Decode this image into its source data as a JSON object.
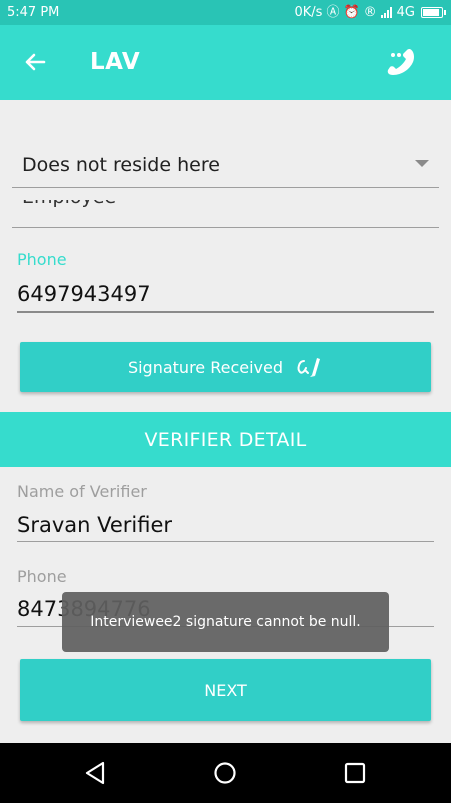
{
  "status_bar": {
    "time": "5:47 PM",
    "net_speed": "0K/s",
    "network": "4G",
    "icons": [
      "data-saver-icon",
      "alarm-icon",
      "registered-icon",
      "signal-icon",
      "battery-icon"
    ]
  },
  "toolbar": {
    "title": "LAV",
    "back_icon": "arrow-left-icon",
    "call_icon": "phone-dots-icon"
  },
  "form": {
    "residence_status": "Does not reside here",
    "clipped_field_value": "Employee",
    "phone_label": "Phone",
    "phone_value": "6497943497",
    "signature_button": "Signature Received",
    "signature_icon": "signature-pen-icon"
  },
  "verifier": {
    "section_title": "VERIFIER DETAIL",
    "name_label": "Name of Verifier",
    "name_value": "Sravan Verifier",
    "phone_label": "Phone",
    "phone_value": "8473894776"
  },
  "next_button": "NEXT",
  "toast": "Interviewee2 signature cannot be null.",
  "nav_bar": {
    "icons": [
      "back-triangle-icon",
      "home-circle-icon",
      "recents-square-icon"
    ]
  },
  "colors": {
    "primary": "#36dccd",
    "button": "#31cfc7",
    "status_bar": "#29c4b5",
    "accent_label": "#36dccd",
    "toast_bg": "#606060"
  }
}
